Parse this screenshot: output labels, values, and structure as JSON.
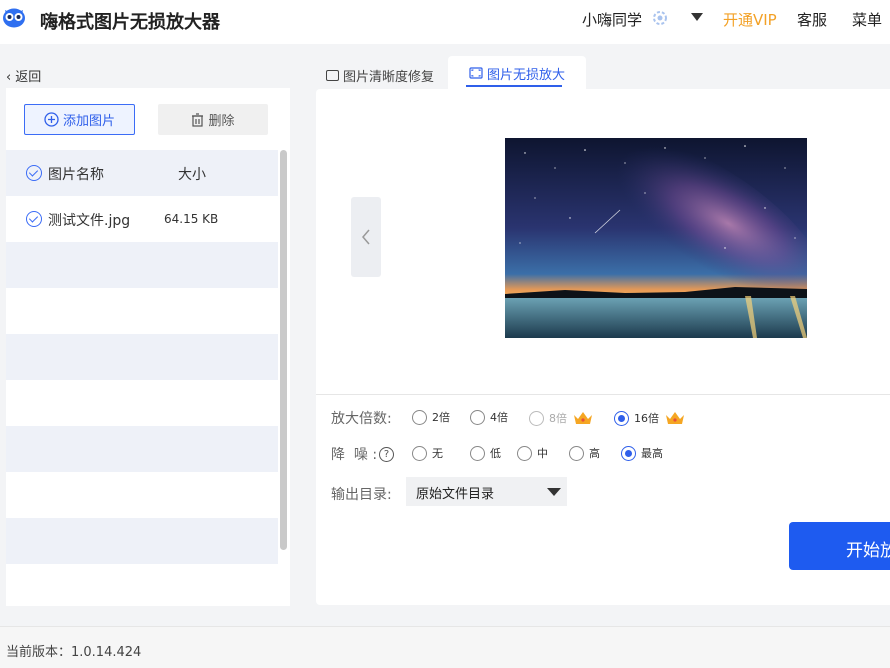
{
  "app": {
    "title": "嗨格式图片无损放大器"
  },
  "header": {
    "user_name": "小嗨同学",
    "vip_label": "开通VIP",
    "service_label": "客服",
    "menu_label": "菜单"
  },
  "nav": {
    "back_label": "返回"
  },
  "tabs": [
    {
      "label": "图片清晰度修复",
      "active": false
    },
    {
      "label": "图片无损放大",
      "active": true
    }
  ],
  "file_panel": {
    "add_label": "添加图片",
    "delete_label": "删除",
    "columns": {
      "name": "图片名称",
      "size": "大小"
    },
    "files": [
      {
        "name": "测试文件.jpg",
        "size": "64.15 KB"
      }
    ]
  },
  "settings": {
    "scale": {
      "label": "放大倍数:",
      "options": [
        {
          "label": "2倍",
          "selected": false,
          "vip": false
        },
        {
          "label": "4倍",
          "selected": false,
          "vip": false
        },
        {
          "label": "8倍",
          "selected": false,
          "vip": true
        },
        {
          "label": "16倍",
          "selected": true,
          "vip": true
        }
      ]
    },
    "denoise": {
      "label": "降  噪 :",
      "options": [
        {
          "label": "无",
          "selected": false
        },
        {
          "label": "低",
          "selected": false
        },
        {
          "label": "中",
          "selected": false
        },
        {
          "label": "高",
          "selected": false
        },
        {
          "label": "最高",
          "selected": true
        }
      ]
    },
    "output": {
      "label": "输出目录:",
      "value": "原始文件目录"
    }
  },
  "actions": {
    "start_label": "开始放大"
  },
  "footer": {
    "version": "当前版本：1.0.14.424"
  },
  "colors": {
    "accent": "#1e5bf0",
    "vip": "#f3a126",
    "crown": "#f5a623"
  }
}
